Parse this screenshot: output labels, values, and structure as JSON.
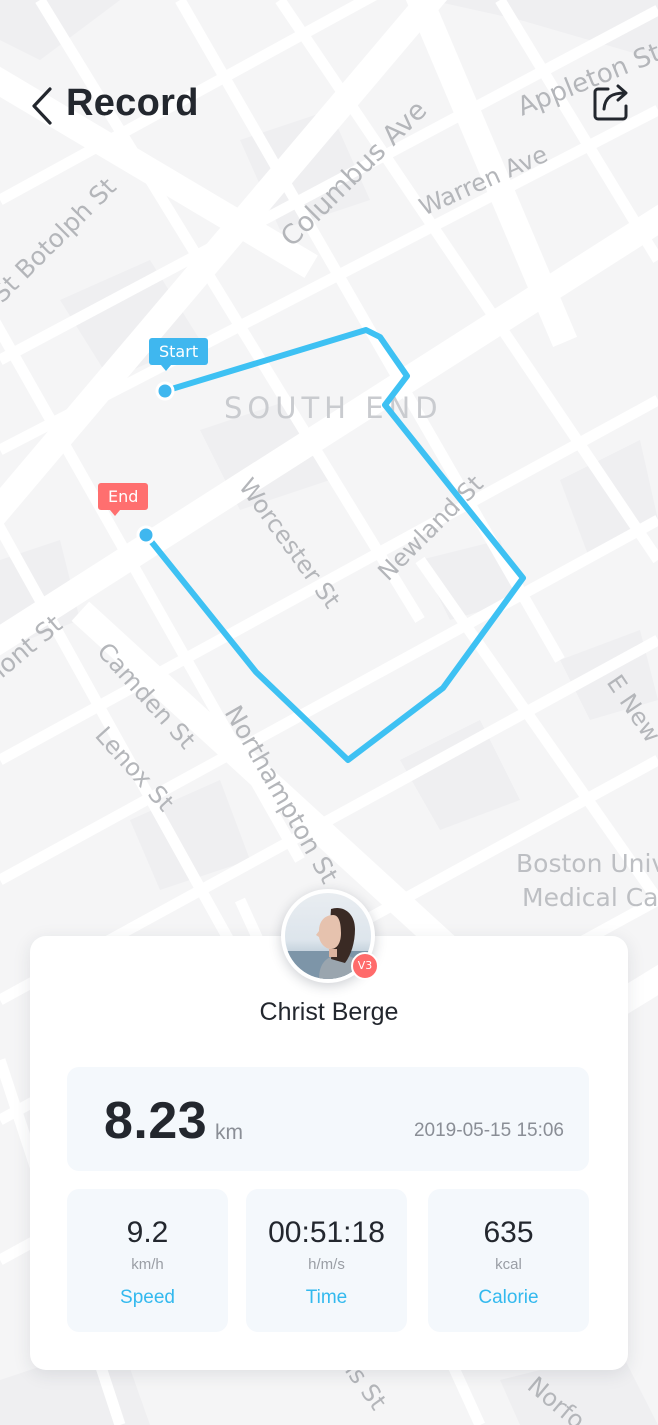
{
  "header": {
    "title": "Record",
    "back_icon": "chevron-left-icon",
    "share_icon": "share-icon"
  },
  "map": {
    "district": "SOUTH END",
    "streets": [
      "Columbus Ave",
      "Appleton St",
      "Warren Ave",
      "St Botolph St",
      "Worcester St",
      "Newland St",
      "Tremont St",
      "Camden St",
      "Lenox St",
      "Northampton St",
      "E New",
      "Boston Univ",
      "Medical Ca",
      "is St",
      "Norfo"
    ],
    "start_label": "Start",
    "end_label": "End",
    "route_color": "#3ec1f3",
    "start_color": "#3fb7ef",
    "end_color": "#ff6f6f"
  },
  "profile": {
    "name": "Christ Berge",
    "level_badge": "V3"
  },
  "summary": {
    "distance": "8.23",
    "distance_unit": "km",
    "datetime": "2019-05-15 15:06"
  },
  "stats": [
    {
      "value": "9.2",
      "unit": "km/h",
      "label": "Speed"
    },
    {
      "value": "00:51:18",
      "unit": "h/m/s",
      "label": "Time"
    },
    {
      "value": "635",
      "unit": "kcal",
      "label": "Calorie"
    }
  ],
  "colors": {
    "accent": "#33b9ee",
    "text": "#23272e",
    "panel": "#f4f8fc"
  }
}
